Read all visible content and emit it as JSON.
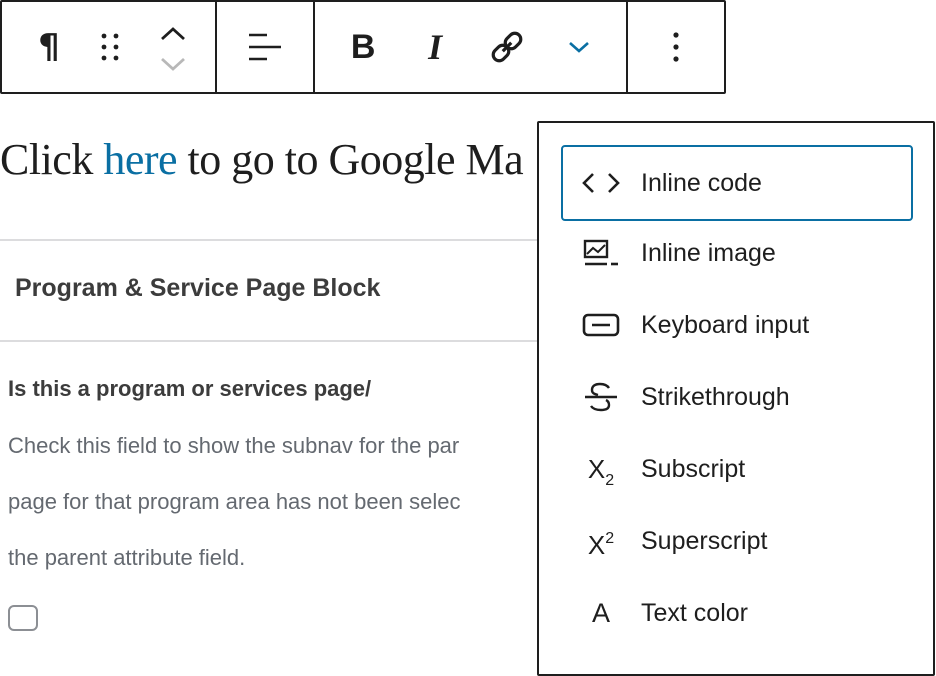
{
  "toolbar": {
    "groups": [
      [
        "paragraph-icon",
        "drag-handle-icon",
        "move-up-icon",
        "move-down-icon"
      ],
      [
        "align-left-icon"
      ],
      [
        "bold-icon",
        "italic-icon",
        "link-icon",
        "chevron-down-icon"
      ],
      [
        "more-options-icon"
      ]
    ],
    "bold_glyph": "B",
    "italic_glyph": "I",
    "paragraph_glyph": "¶",
    "accent_color": "#0a6fa3"
  },
  "content": {
    "paragraph_before": "Click ",
    "paragraph_link": "here",
    "paragraph_after": " to go to Google Ma",
    "block_title": "Program & Service Page Block",
    "field_label": "Is this a program or services page/",
    "field_help_lines": [
      "Check this field to show the subnav for the par",
      "page for that program area has not been selec",
      "the parent attribute field."
    ],
    "checkbox_checked": false
  },
  "dropdown": {
    "items": [
      {
        "label": "Inline code",
        "icon": "code-icon",
        "focused": true
      },
      {
        "label": "Inline image",
        "icon": "image-icon",
        "focused": false
      },
      {
        "label": "Keyboard input",
        "icon": "keyboard-icon",
        "focused": false
      },
      {
        "label": "Strikethrough",
        "icon": "strikethrough-icon",
        "focused": false
      },
      {
        "label": "Subscript",
        "icon": "subscript-icon",
        "focused": false
      },
      {
        "label": "Superscript",
        "icon": "superscript-icon",
        "focused": false
      },
      {
        "label": "Text color",
        "icon": "text-color-icon",
        "focused": false
      }
    ],
    "subscript_base": "X",
    "subscript_sub": "2",
    "superscript_base": "X",
    "superscript_sup": "2",
    "text_color_glyph": "A"
  }
}
